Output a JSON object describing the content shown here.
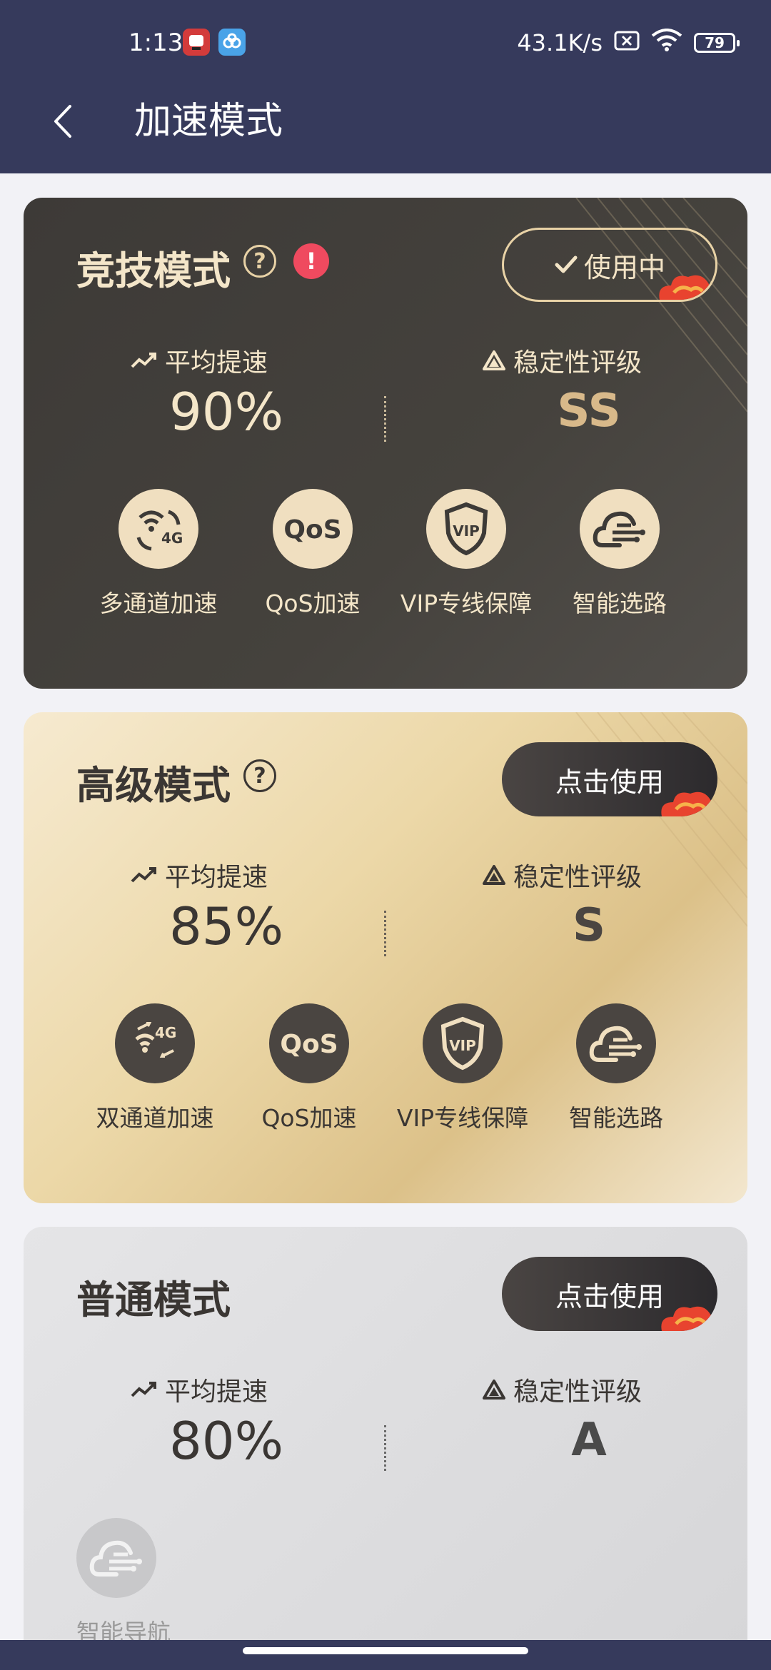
{
  "status_bar": {
    "time": "1:13",
    "net_speed": "43.1K/s",
    "battery": "79"
  },
  "header": {
    "title": "加速模式"
  },
  "modes": [
    {
      "name": "竞技模式",
      "button_label": "使用中",
      "speed_label": "平均提速",
      "speed_value": "90%",
      "stability_label": "稳定性评级",
      "stability_value": "SS",
      "features": [
        {
          "label": "多通道加速",
          "icon": "multi-channel-4g-icon"
        },
        {
          "label": "QoS加速",
          "icon": "qos-icon"
        },
        {
          "label": "VIP专线保障",
          "icon": "vip-shield-icon"
        },
        {
          "label": "智能选路",
          "icon": "smart-routing-cloud-icon"
        }
      ]
    },
    {
      "name": "高级模式",
      "button_label": "点击使用",
      "speed_label": "平均提速",
      "speed_value": "85%",
      "stability_label": "稳定性评级",
      "stability_value": "S",
      "features": [
        {
          "label": "双通道加速",
          "icon": "dual-channel-4g-icon"
        },
        {
          "label": "QoS加速",
          "icon": "qos-icon"
        },
        {
          "label": "VIP专线保障",
          "icon": "vip-shield-icon"
        },
        {
          "label": "智能选路",
          "icon": "smart-routing-cloud-icon"
        }
      ]
    },
    {
      "name": "普通模式",
      "button_label": "点击使用",
      "speed_label": "平均提速",
      "speed_value": "80%",
      "stability_label": "稳定性评级",
      "stability_value": "A",
      "features": [
        {
          "label": "智能导航",
          "icon": "smart-navigation-cloud-icon"
        }
      ]
    }
  ],
  "colors": {
    "header_bg": "#363a5c",
    "gold": "#e8d2a6",
    "warning": "#ef4a5f"
  }
}
